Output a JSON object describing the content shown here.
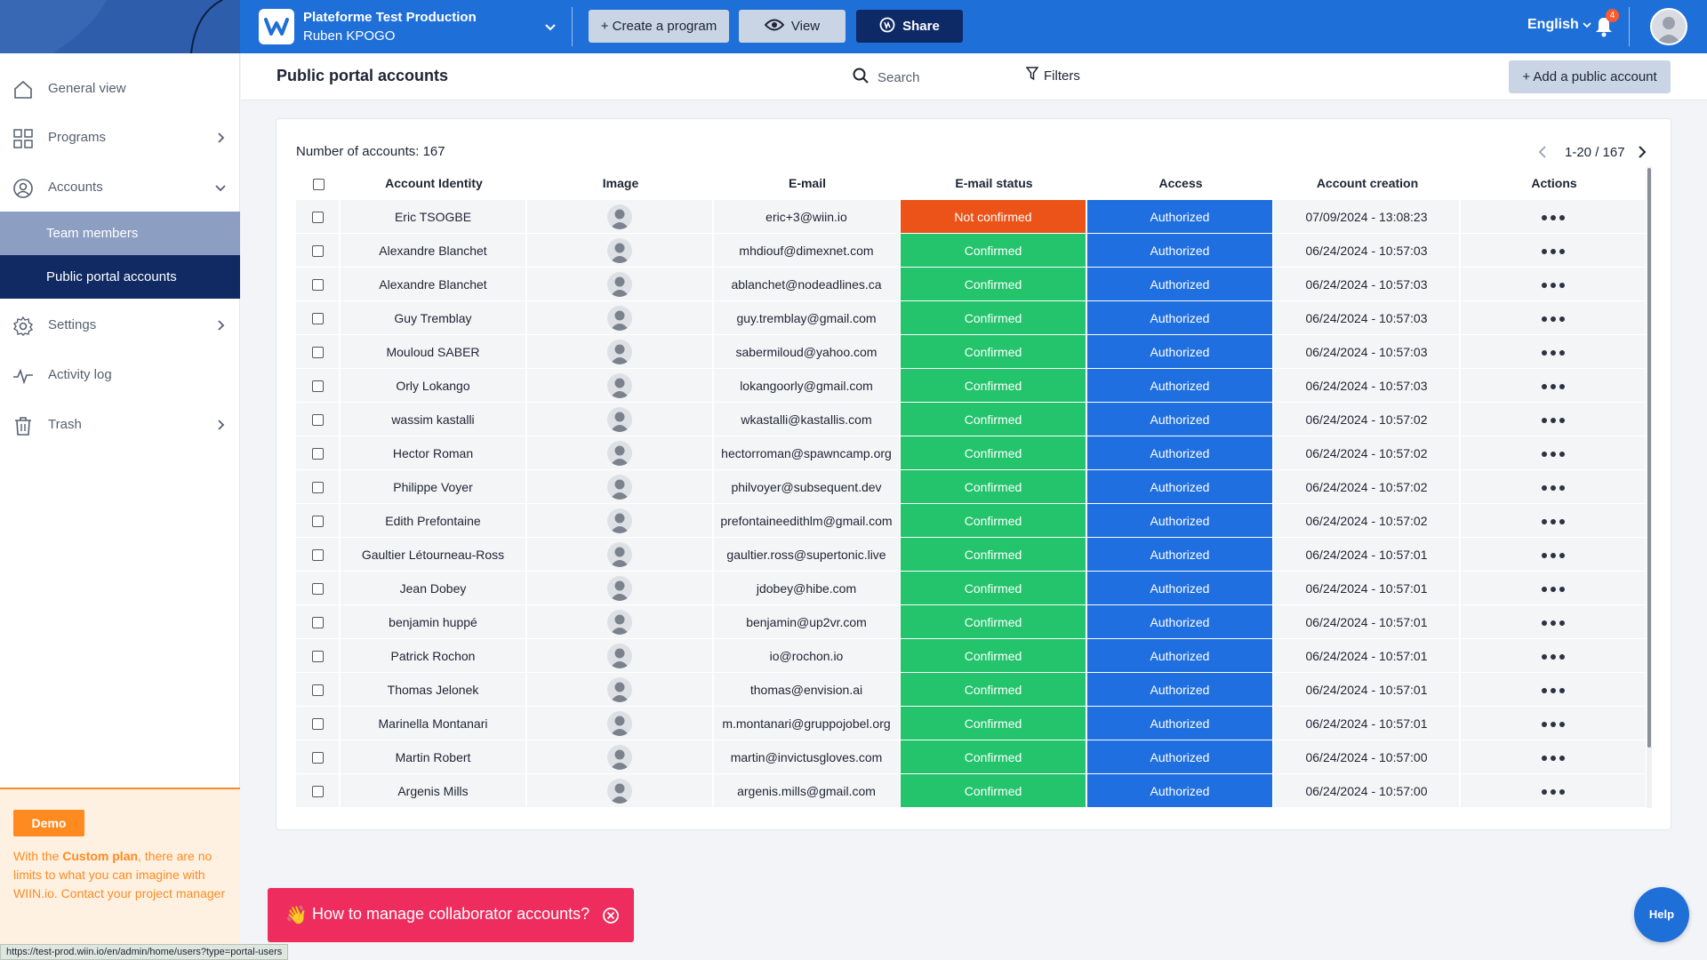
{
  "topbar": {
    "workspace_title": "Plateforme Test Production",
    "workspace_user": "Ruben KPOGO",
    "create_label": "+ Create a program",
    "view_label": "View",
    "share_label": "Share",
    "language": "English",
    "notification_count": "4"
  },
  "sidebar": {
    "items": [
      {
        "label": "General view",
        "icon": "home-icon"
      },
      {
        "label": "Programs",
        "icon": "grid-icon"
      },
      {
        "label": "Accounts",
        "icon": "user-circle-icon"
      },
      {
        "label": "Settings",
        "icon": "gear-icon"
      },
      {
        "label": "Activity log",
        "icon": "activity-icon"
      },
      {
        "label": "Trash",
        "icon": "trash-icon"
      }
    ],
    "sub_items": [
      "Team members",
      "Public portal accounts"
    ],
    "promo": {
      "button": "Demo",
      "text_before": "With the ",
      "highlight": "Custom plan",
      "text_after": ", there are no limits to what you can imagine with WIIN.io. Contact your project manager"
    },
    "status_url": "https://test-prod.wiin.io/en/admin/home/users?type=portal-users"
  },
  "page": {
    "title": "Public portal accounts",
    "search_placeholder": "Search",
    "filters_label": "Filters",
    "add_label": "+ Add a public account"
  },
  "table": {
    "count_label": "Number of accounts: 167",
    "pagination": "1-20 / 167",
    "columns": [
      "Account Identity",
      "Image",
      "E-mail",
      "E-mail status",
      "Access",
      "Account creation",
      "Actions"
    ],
    "rows": [
      {
        "name": "Eric TSOGBE",
        "email": "eric+3@wiin.io",
        "status": "Not confirmed",
        "access": "Authorized",
        "created": "07/09/2024 - 13:08:23"
      },
      {
        "name": "Alexandre Blanchet",
        "email": "mhdiouf@dimexnet.com",
        "status": "Confirmed",
        "access": "Authorized",
        "created": "06/24/2024 - 10:57:03"
      },
      {
        "name": "Alexandre Blanchet",
        "email": "ablanchet@nodeadlines.ca",
        "status": "Confirmed",
        "access": "Authorized",
        "created": "06/24/2024 - 10:57:03"
      },
      {
        "name": "Guy Tremblay",
        "email": "guy.tremblay@gmail.com",
        "status": "Confirmed",
        "access": "Authorized",
        "created": "06/24/2024 - 10:57:03"
      },
      {
        "name": "Mouloud SABER",
        "email": "sabermiloud@yahoo.com",
        "status": "Confirmed",
        "access": "Authorized",
        "created": "06/24/2024 - 10:57:03"
      },
      {
        "name": "Orly Lokango",
        "email": "lokangoorly@gmail.com",
        "status": "Confirmed",
        "access": "Authorized",
        "created": "06/24/2024 - 10:57:03"
      },
      {
        "name": "wassim kastalli",
        "email": "wkastalli@kastallis.com",
        "status": "Confirmed",
        "access": "Authorized",
        "created": "06/24/2024 - 10:57:02"
      },
      {
        "name": "Hector Roman",
        "email": "hectorroman@spawncamp.org",
        "status": "Confirmed",
        "access": "Authorized",
        "created": "06/24/2024 - 10:57:02"
      },
      {
        "name": "Philippe Voyer",
        "email": "philvoyer@subsequent.dev",
        "status": "Confirmed",
        "access": "Authorized",
        "created": "06/24/2024 - 10:57:02"
      },
      {
        "name": "Edith Prefontaine",
        "email": "prefontaineedithlm@gmail.com",
        "status": "Confirmed",
        "access": "Authorized",
        "created": "06/24/2024 - 10:57:02"
      },
      {
        "name": "Gaultier Létourneau-Ross",
        "email": "gaultier.ross@supertonic.live",
        "status": "Confirmed",
        "access": "Authorized",
        "created": "06/24/2024 - 10:57:01"
      },
      {
        "name": "Jean Dobey",
        "email": "jdobey@hibe.com",
        "status": "Confirmed",
        "access": "Authorized",
        "created": "06/24/2024 - 10:57:01"
      },
      {
        "name": "benjamin huppé",
        "email": "benjamin@up2vr.com",
        "status": "Confirmed",
        "access": "Authorized",
        "created": "06/24/2024 - 10:57:01"
      },
      {
        "name": "Patrick Rochon",
        "email": "io@rochon.io",
        "status": "Confirmed",
        "access": "Authorized",
        "created": "06/24/2024 - 10:57:01"
      },
      {
        "name": "Thomas Jelonek",
        "email": "thomas@envision.ai",
        "status": "Confirmed",
        "access": "Authorized",
        "created": "06/24/2024 - 10:57:01"
      },
      {
        "name": "Marinella Montanari",
        "email": "m.montanari@gruppojobel.org",
        "status": "Confirmed",
        "access": "Authorized",
        "created": "06/24/2024 - 10:57:01"
      },
      {
        "name": "Martin Robert",
        "email": "martin@invictusgloves.com",
        "status": "Confirmed",
        "access": "Authorized",
        "created": "06/24/2024 - 10:57:00"
      },
      {
        "name": "Argenis Mills",
        "email": "argenis.mills@gmail.com",
        "status": "Confirmed",
        "access": "Authorized",
        "created": "06/24/2024 - 10:57:00"
      }
    ]
  },
  "toast": {
    "emoji": "👋",
    "text": "How to manage collaborator accounts?"
  },
  "help_label": "Help",
  "colors": {
    "brand": "#1f6fd9",
    "confirmed": "#23c46b",
    "not_confirmed": "#ec5319",
    "access": "#1f6fe0",
    "accent_orange": "#ff8a1f"
  }
}
